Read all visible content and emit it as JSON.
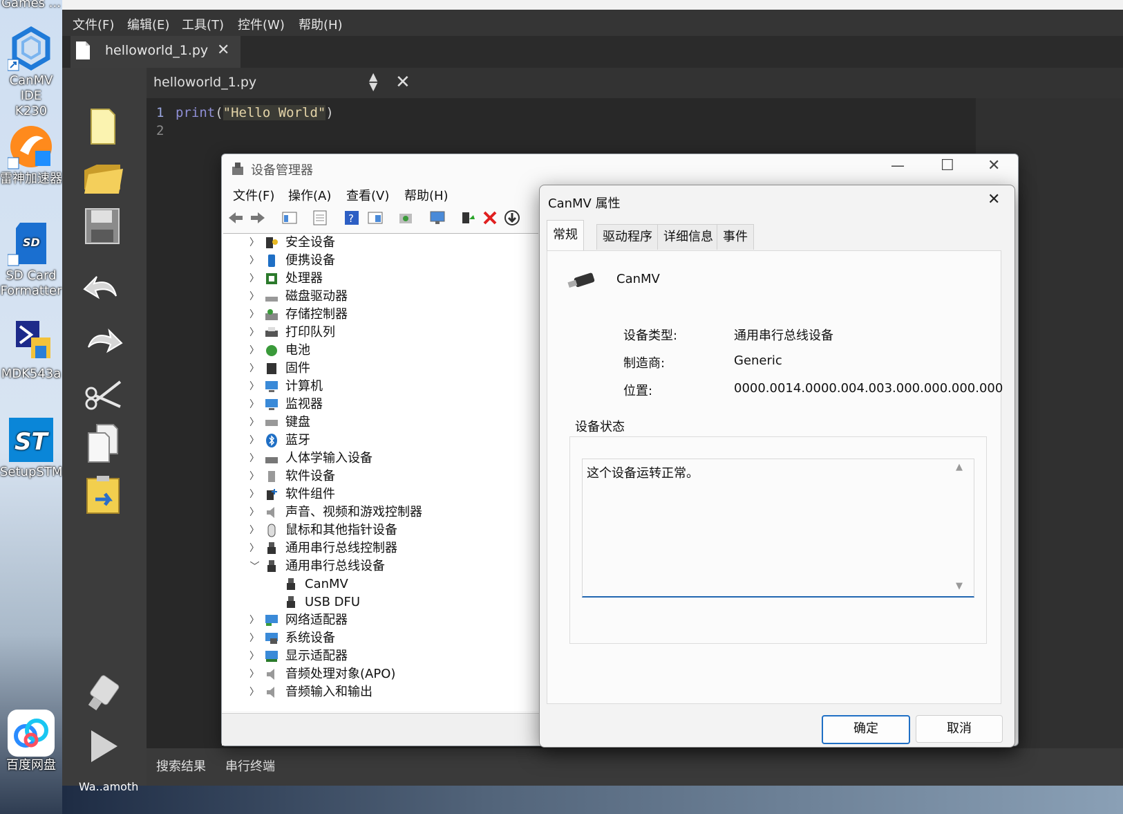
{
  "desktop": {
    "top_label": "Games ...",
    "icons": [
      {
        "label_line1": "CanMV IDE",
        "label_line2": "K230",
        "icon": "canmv-hexagon-icon"
      },
      {
        "label_line1": "雷神加速器",
        "label_line2": "",
        "icon": "leishen-accelerator-icon"
      },
      {
        "label_line1": "SD Card",
        "label_line2": "Formatter",
        "icon": "sd-card-icon"
      },
      {
        "label_line1": "MDK543a",
        "label_line2": "",
        "icon": "keil-mdk-icon"
      },
      {
        "label_line1": "SetupSTM...",
        "label_line2": "",
        "icon": "st-logo-icon"
      },
      {
        "label_line1": "百度网盘",
        "label_line2": "",
        "icon": "baidu-netdisk-icon"
      }
    ]
  },
  "ide": {
    "menu": [
      "文件(F)",
      "编辑(E)",
      "工具(T)",
      "控件(W)",
      "帮助(H)"
    ],
    "file_tab": "helloworld_1.py",
    "editor_file": "helloworld_1.py",
    "code": {
      "line1_no": "1",
      "line2_no": "2",
      "func": "print",
      "open": "(",
      "string": "\"Hello World\"",
      "close": ")"
    },
    "bottom_tabs": [
      "搜索结果",
      "串行终端"
    ],
    "toolbar_icons": [
      "new-file-icon",
      "open-folder-icon",
      "save-icon",
      "undo-icon",
      "redo-icon",
      "cut-icon",
      "copy-icon",
      "paste-icon",
      "connect-icon",
      "run-icon"
    ],
    "bottom_overflow_text": "Wa..amoth"
  },
  "devmgr": {
    "title": "设备管理器",
    "menu": [
      "文件(F)",
      "操作(A)",
      "查看(V)",
      "帮助(H)"
    ],
    "tree": [
      {
        "label": "安全设备",
        "icon": "security-device-icon",
        "expanded": false
      },
      {
        "label": "便携设备",
        "icon": "portable-device-icon",
        "expanded": false
      },
      {
        "label": "处理器",
        "icon": "processor-icon",
        "expanded": false
      },
      {
        "label": "磁盘驱动器",
        "icon": "disk-drive-icon",
        "expanded": false
      },
      {
        "label": "存储控制器",
        "icon": "storage-controller-icon",
        "expanded": false
      },
      {
        "label": "打印队列",
        "icon": "printer-icon",
        "expanded": false
      },
      {
        "label": "电池",
        "icon": "battery-icon",
        "expanded": false
      },
      {
        "label": "固件",
        "icon": "firmware-icon",
        "expanded": false
      },
      {
        "label": "计算机",
        "icon": "computer-icon",
        "expanded": false
      },
      {
        "label": "监视器",
        "icon": "monitor-icon",
        "expanded": false
      },
      {
        "label": "键盘",
        "icon": "keyboard-icon",
        "expanded": false
      },
      {
        "label": "蓝牙",
        "icon": "bluetooth-icon",
        "expanded": false
      },
      {
        "label": "人体学输入设备",
        "icon": "hid-icon",
        "expanded": false
      },
      {
        "label": "软件设备",
        "icon": "software-device-icon",
        "expanded": false
      },
      {
        "label": "软件组件",
        "icon": "software-component-icon",
        "expanded": false
      },
      {
        "label": "声音、视频和游戏控制器",
        "icon": "audio-icon",
        "expanded": false
      },
      {
        "label": "鼠标和其他指针设备",
        "icon": "mouse-icon",
        "expanded": false
      },
      {
        "label": "通用串行总线控制器",
        "icon": "usb-icon",
        "expanded": false
      },
      {
        "label": "通用串行总线设备",
        "icon": "usb-icon",
        "expanded": true
      },
      {
        "label": "CanMV",
        "icon": "usb-icon",
        "child": true
      },
      {
        "label": "USB DFU",
        "icon": "usb-icon",
        "child": true
      },
      {
        "label": "网络适配器",
        "icon": "network-adapter-icon",
        "expanded": false
      },
      {
        "label": "系统设备",
        "icon": "system-device-icon",
        "expanded": false
      },
      {
        "label": "显示适配器",
        "icon": "display-adapter-icon",
        "expanded": false
      },
      {
        "label": "音频处理对象(APO)",
        "icon": "audio-icon",
        "expanded": false
      },
      {
        "label": "音频输入和输出",
        "icon": "audio-icon",
        "expanded": false
      }
    ]
  },
  "props": {
    "title": "CanMV 属性",
    "tabs": [
      "常规",
      "驱动程序",
      "详细信息",
      "事件"
    ],
    "device_name": "CanMV",
    "fields": {
      "type_label": "设备类型:",
      "type_value": "通用串行总线设备",
      "mfr_label": "制造商:",
      "mfr_value": "Generic",
      "loc_label": "位置:",
      "loc_value": "0000.0014.0000.004.003.000.000.000.000"
    },
    "status_group": "设备状态",
    "status_text": "这个设备运转正常。",
    "ok": "确定",
    "cancel": "取消"
  },
  "colors": {
    "ide_bg": "#2b2b2b",
    "accent": "#1f6fc5",
    "code_string": "#e4d4a8",
    "code_func": "#8f8fd6"
  }
}
